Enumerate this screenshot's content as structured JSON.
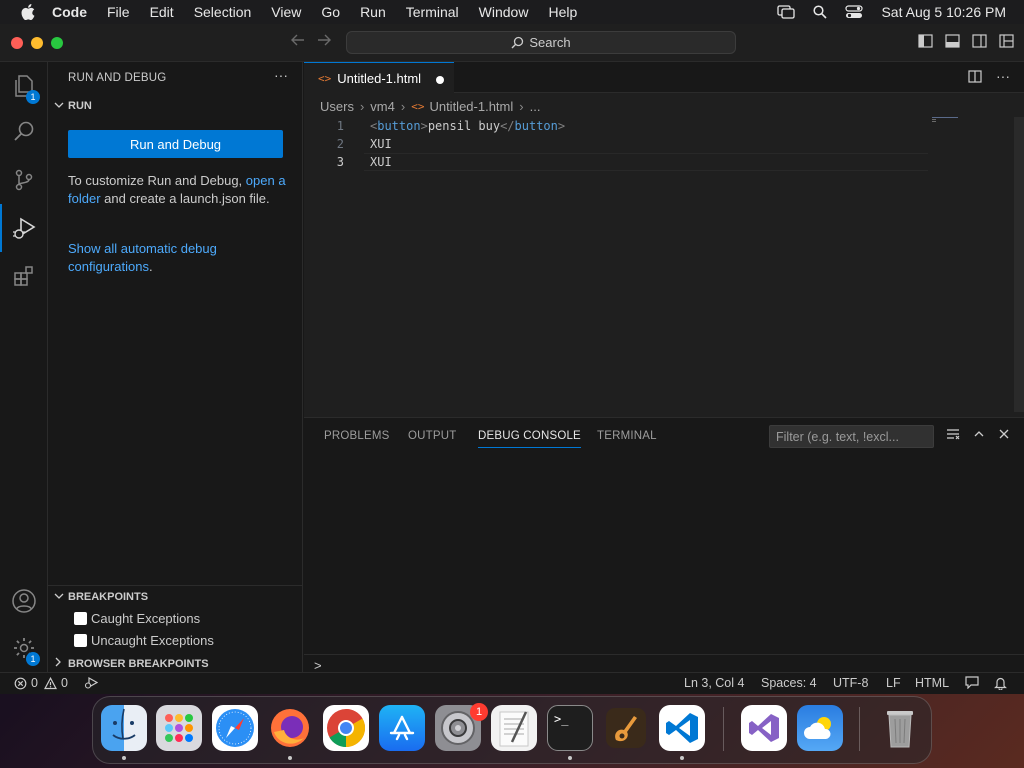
{
  "menubar": {
    "app_name": "Code",
    "items": [
      "File",
      "Edit",
      "Selection",
      "View",
      "Go",
      "Run",
      "Terminal",
      "Window",
      "Help"
    ],
    "datetime": "Sat Aug 5  10:26 PM",
    "icons": [
      "apple-icon",
      "screen-mirror-icon",
      "spotlight-search-icon",
      "control-center-icon"
    ]
  },
  "titlebar": {
    "search_label": "Search"
  },
  "activitybar": {
    "explorer_badge": "1",
    "settings_badge": "1"
  },
  "sidebar": {
    "title": "RUN AND DEBUG",
    "more": "···",
    "run_section": "RUN",
    "run_button": "Run and Debug",
    "customize_text_1": "To customize Run and Debug, ",
    "customize_link": "open a folder",
    "customize_text_2": " and create a launch.json file.",
    "show_link": "Show all automatic debug configurations",
    "show_suffix": ".",
    "breakpoints_section": "BREAKPOINTS",
    "breakpoints": [
      {
        "label": "Caught Exceptions",
        "checked": false
      },
      {
        "label": "Uncaught Exceptions",
        "checked": false
      }
    ],
    "browser_breakpoints_section": "BROWSER BREAKPOINTS"
  },
  "editor": {
    "tab_title": "Untitled-1.html",
    "breadcrumb": [
      "Users",
      "vm4",
      "Untitled-1.html",
      "..."
    ],
    "lines": [
      {
        "number": "1",
        "open_tag": "button",
        "text": "pensil buy",
        "close_tag": "button"
      },
      {
        "number": "2",
        "text": "XUI"
      },
      {
        "number": "3",
        "text": "XUI"
      }
    ],
    "lt": "<",
    "gt": ">",
    "lts": "</"
  },
  "panel": {
    "tabs": [
      "PROBLEMS",
      "OUTPUT",
      "DEBUG CONSOLE",
      "TERMINAL"
    ],
    "active_tab": "DEBUG CONSOLE",
    "filter_placeholder": "Filter (e.g. text, !excl...",
    "prompt": ">"
  },
  "statusbar": {
    "errors": "0",
    "warnings": "0",
    "position": "Ln 3, Col 4",
    "spaces": "Spaces: 4",
    "encoding": "UTF-8",
    "eol": "LF",
    "language": "HTML"
  },
  "dock": {
    "apps": [
      "Finder",
      "Launchpad",
      "Safari",
      "Firefox",
      "Chrome",
      "App Store",
      "System Settings",
      "TextEdit",
      "Terminal",
      "GarageBand",
      "VS Code",
      "Visual Studio",
      "Weather",
      "Trash"
    ],
    "settings_badge": "1"
  },
  "colors": {
    "accent": "#0078d4",
    "link": "#4daafc",
    "html_icon": "#e37933",
    "tag": "#569cd6"
  }
}
